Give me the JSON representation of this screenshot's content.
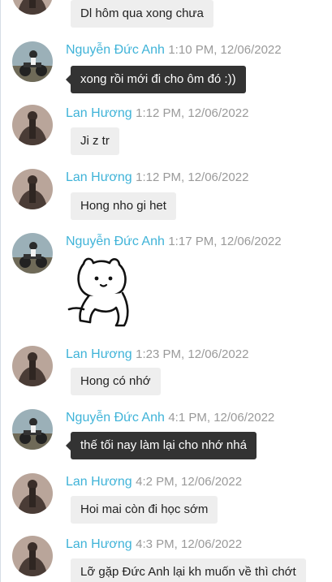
{
  "messages": [
    {
      "sender": "",
      "time": "",
      "text": "Dl hôm qua xong chưa",
      "kind": "in",
      "avatar": "lan"
    },
    {
      "sender": "Nguyễn Đức Anh",
      "time": "1:10 PM, 12/06/2022",
      "text": "xong rồi mới đi cho ôm đó :))",
      "kind": "out",
      "avatar": "anh"
    },
    {
      "sender": "Lan Hương",
      "time": "1:12 PM, 12/06/2022",
      "text": "Ji z tr",
      "kind": "in",
      "avatar": "lan"
    },
    {
      "sender": "Lan Hương",
      "time": "1:12 PM, 12/06/2022",
      "text": "Hong nho gi het",
      "kind": "in",
      "avatar": "lan"
    },
    {
      "sender": "Nguyễn Đức Anh",
      "time": "1:17 PM, 12/06/2022",
      "text": "",
      "kind": "sticker",
      "avatar": "anh",
      "sticker": "cat-sticker"
    },
    {
      "sender": "Lan Hương",
      "time": "1:23 PM, 12/06/2022",
      "text": "Hong có nhớ",
      "kind": "in",
      "avatar": "lan"
    },
    {
      "sender": "Nguyễn Đức Anh",
      "time": "4:1 PM, 12/06/2022",
      "text": "thế tối nay làm lại cho nhớ nhá",
      "kind": "out",
      "avatar": "anh"
    },
    {
      "sender": "Lan Hương",
      "time": "4:2 PM, 12/06/2022",
      "text": "Hoi mai còn đi học sớm",
      "kind": "in",
      "avatar": "lan"
    },
    {
      "sender": "Lan Hương",
      "time": "4:3 PM, 12/06/2022",
      "text": "Lỡ gặp Đức Anh lại kh muốn về thì chớt",
      "kind": "in",
      "avatar": "lan"
    }
  ],
  "colors": {
    "name": "#3fb3d8",
    "time": "#9a9a9a",
    "bubble_in": "#eeeeee",
    "bubble_out": "#333333"
  }
}
